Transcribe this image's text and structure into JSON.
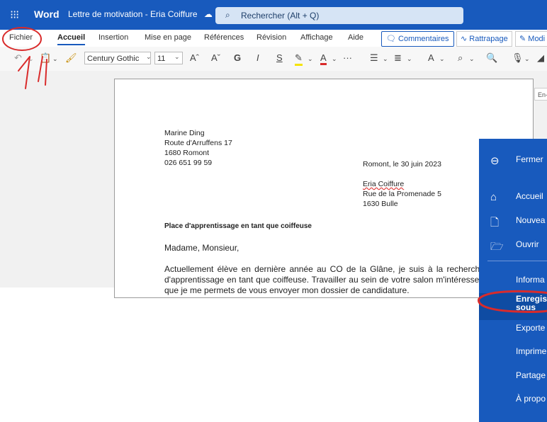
{
  "app": {
    "name": "Word",
    "waffle_icon": "waffle-icon"
  },
  "document": {
    "title": "Lettre de motivation - Eria Coiffure",
    "save_status_icon": "cloud-saved-icon"
  },
  "search": {
    "placeholder": "Rechercher (Alt + Q)"
  },
  "tabs": [
    {
      "label": "Fichier"
    },
    {
      "label": "Accueil"
    },
    {
      "label": "Insertion"
    },
    {
      "label": "Mise en page"
    },
    {
      "label": "Références"
    },
    {
      "label": "Révision"
    },
    {
      "label": "Affichage"
    },
    {
      "label": "Aide"
    }
  ],
  "ribbon_buttons": {
    "comments": "Commentaires",
    "tracking": "Rattrapage",
    "editing": "Modi"
  },
  "toolbar": {
    "font": "Century Gothic",
    "size": "11",
    "bold": "G",
    "italic": "I",
    "underline": "S"
  },
  "language_box": "En-",
  "letter": {
    "sender": [
      "Marine Ding",
      "Route d'Arruffens 17",
      "1680 Romont",
      "026 651 99 59"
    ],
    "date_line": "Romont, le 30 juin 2023",
    "recipient": [
      "Eria Coiffure",
      "Rue de la Promenade 5",
      "1630 Bulle"
    ],
    "subject": "Place d'apprentissage en tant que coiffeuse",
    "salutation": "Madame, Monsieur,",
    "body": "Actuellement élève en dernière année au CO de la Glâne, je suis à la recherche d'une place d'apprentissage en tant que coiffeuse. Travailler au sein de votre salon m'intéresse, c'est pour ce que je me permets de vous envoyer mon dossier de candidature."
  },
  "file_panel": {
    "items": [
      {
        "label": "Fermer"
      },
      {
        "label": "Accueil"
      },
      {
        "label": "Nouvea"
      },
      {
        "label": "Ouvrir"
      },
      {
        "label": "Informa"
      },
      {
        "label": "Enregis"
      },
      {
        "label": "Exporte"
      },
      {
        "label": "Imprime"
      },
      {
        "label": "Partage"
      },
      {
        "label": "À propo"
      }
    ],
    "save_as_line2": "sous"
  },
  "annotation_color": "#d92b2b",
  "theme_color": "#185abd"
}
